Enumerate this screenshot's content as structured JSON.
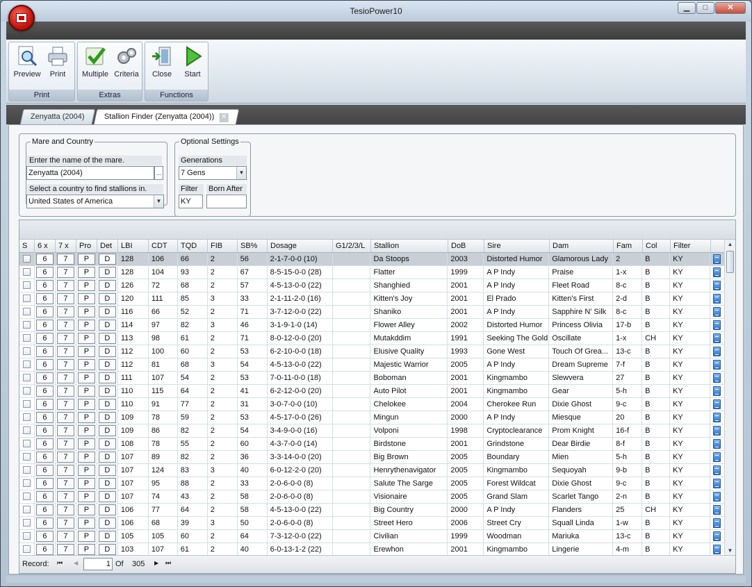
{
  "app": {
    "title": "TesioPower10"
  },
  "window_controls": {
    "minimize": "▁",
    "maximize": "□",
    "close": "✕"
  },
  "ribbon": {
    "groups": [
      {
        "title": "Print",
        "buttons": [
          "Preview",
          "Print"
        ]
      },
      {
        "title": "Extras",
        "buttons": [
          "Multiple",
          "Criteria"
        ]
      },
      {
        "title": "Functions",
        "buttons": [
          "Close",
          "Start"
        ]
      }
    ]
  },
  "tabs": [
    {
      "label": "Zenyatta (2004)"
    },
    {
      "label": "Stallion Finder (Zenyatta (2004))",
      "close": "✕"
    }
  ],
  "mare_country": {
    "legend": "Mare and Country",
    "mare_prompt": "Enter the name of the mare.",
    "mare_value": "Zenyatta (2004)",
    "browse": "...",
    "country_prompt": "Select a country to find stallions in.",
    "country_value": "United States of America"
  },
  "optional": {
    "legend": "Optional Settings",
    "generations_label": "Generations",
    "generations_value": "7 Gens",
    "filter_label": "Filter",
    "filter_value": "KY",
    "born_after_label": "Born After",
    "born_after_value": ""
  },
  "grid": {
    "columns": [
      "S",
      "6 x",
      "7 x",
      "Pro",
      "Det",
      "LBI",
      "CDT",
      "TQD",
      "FIB",
      "SB%",
      "Dosage",
      "G1/2/3/L",
      "Stallion",
      "DoB",
      "Sire",
      "Dam",
      "Fam",
      "Col",
      "Filter"
    ],
    "rows": [
      [
        "128",
        "106",
        "66",
        "2",
        "56",
        "2-1-7-0-0 (10)",
        "Da Stoops",
        "2003",
        "Distorted Humor",
        "Glamorous Lady",
        "2",
        "B",
        "KY"
      ],
      [
        "128",
        "104",
        "93",
        "2",
        "67",
        "8-5-15-0-0 (28)",
        "Flatter",
        "1999",
        "A P Indy",
        "Praise",
        "1-x",
        "B",
        "KY"
      ],
      [
        "126",
        "72",
        "68",
        "2",
        "57",
        "4-5-13-0-0 (22)",
        "Shanghied",
        "2001",
        "A P Indy",
        "Fleet Road",
        "8-c",
        "B",
        "KY"
      ],
      [
        "120",
        "111",
        "85",
        "3",
        "33",
        "2-1-11-2-0 (16)",
        "Kitten's Joy",
        "2001",
        "El Prado",
        "Kitten's First",
        "2-d",
        "B",
        "KY"
      ],
      [
        "116",
        "66",
        "52",
        "2",
        "71",
        "3-7-12-0-0 (22)",
        "Shaniko",
        "2001",
        "A P Indy",
        "Sapphire N' Silk",
        "8-c",
        "B",
        "KY"
      ],
      [
        "114",
        "97",
        "82",
        "3",
        "46",
        "3-1-9-1-0 (14)",
        "Flower Alley",
        "2002",
        "Distorted Humor",
        "Princess Olivia",
        "17-b",
        "B",
        "KY"
      ],
      [
        "113",
        "98",
        "61",
        "2",
        "71",
        "8-0-12-0-0 (20)",
        "Mutakddim",
        "1991",
        "Seeking The Gold",
        "Oscillate",
        "1-x",
        "CH",
        "KY"
      ],
      [
        "112",
        "100",
        "60",
        "2",
        "53",
        "6-2-10-0-0 (18)",
        "Elusive Quality",
        "1993",
        "Gone West",
        "Touch Of Grea...",
        "13-c",
        "B",
        "KY"
      ],
      [
        "112",
        "81",
        "68",
        "3",
        "54",
        "4-5-13-0-0 (22)",
        "Majestic Warrior",
        "2005",
        "A P Indy",
        "Dream Supreme",
        "7-f",
        "B",
        "KY"
      ],
      [
        "111",
        "107",
        "54",
        "2",
        "53",
        "7-0-11-0-0 (18)",
        "Boboman",
        "2001",
        "Kingmambo",
        "Slewvera",
        "27",
        "B",
        "KY"
      ],
      [
        "110",
        "115",
        "64",
        "2",
        "41",
        "6-2-12-0-0 (20)",
        "Auto Pilot",
        "2001",
        "Kingmambo",
        "Gear",
        "5-h",
        "B",
        "KY"
      ],
      [
        "110",
        "91",
        "77",
        "2",
        "31",
        "3-0-7-0-0 (10)",
        "Chelokee",
        "2004",
        "Cherokee Run",
        "Dixie Ghost",
        "9-c",
        "B",
        "KY"
      ],
      [
        "109",
        "78",
        "59",
        "2",
        "53",
        "4-5-17-0-0 (26)",
        "Mingun",
        "2000",
        "A P Indy",
        "Miesque",
        "20",
        "B",
        "KY"
      ],
      [
        "109",
        "86",
        "82",
        "2",
        "54",
        "3-4-9-0-0 (16)",
        "Volponi",
        "1998",
        "Cryptoclearance",
        "Prom Knight",
        "16-f",
        "B",
        "KY"
      ],
      [
        "108",
        "78",
        "55",
        "2",
        "60",
        "4-3-7-0-0 (14)",
        "Birdstone",
        "2001",
        "Grindstone",
        "Dear Birdie",
        "8-f",
        "B",
        "KY"
      ],
      [
        "107",
        "89",
        "82",
        "2",
        "36",
        "3-3-14-0-0 (20)",
        "Big Brown",
        "2005",
        "Boundary",
        "Mien",
        "5-h",
        "B",
        "KY"
      ],
      [
        "107",
        "124",
        "83",
        "3",
        "40",
        "6-0-12-2-0 (20)",
        "Henrythenavigator",
        "2005",
        "Kingmambo",
        "Sequoyah",
        "9-b",
        "B",
        "KY"
      ],
      [
        "107",
        "95",
        "88",
        "2",
        "33",
        "2-0-6-0-0 (8)",
        "Salute The Sarge",
        "2005",
        "Forest Wildcat",
        "Dixie Ghost",
        "9-c",
        "B",
        "KY"
      ],
      [
        "107",
        "74",
        "43",
        "2",
        "58",
        "2-0-6-0-0 (8)",
        "Visionaire",
        "2005",
        "Grand Slam",
        "Scarlet Tango",
        "2-n",
        "B",
        "KY"
      ],
      [
        "106",
        "77",
        "64",
        "2",
        "58",
        "4-5-13-0-0 (22)",
        "Big Country",
        "2000",
        "A P Indy",
        "Flanders",
        "25",
        "CH",
        "KY"
      ],
      [
        "106",
        "68",
        "39",
        "3",
        "50",
        "2-0-6-0-0 (8)",
        "Street Hero",
        "2006",
        "Street Cry",
        "Squall Linda",
        "1-w",
        "B",
        "KY"
      ],
      [
        "105",
        "105",
        "60",
        "2",
        "64",
        "7-3-12-0-0 (22)",
        "Civilian",
        "1999",
        "Woodman",
        "Mariuka",
        "13-c",
        "B",
        "KY"
      ],
      [
        "103",
        "107",
        "61",
        "2",
        "40",
        "6-0-13-1-2 (22)",
        "Erewhon",
        "2001",
        "Kingmambo",
        "Lingerie",
        "4-m",
        "B",
        "KY"
      ]
    ],
    "box_labels": [
      "6",
      "7",
      "P",
      "D"
    ]
  },
  "navigator": {
    "label": "Record:",
    "first": "⏮",
    "prev": "◀",
    "current": "1",
    "of": "Of",
    "total": "305",
    "next": "▶",
    "last": "⏭"
  }
}
